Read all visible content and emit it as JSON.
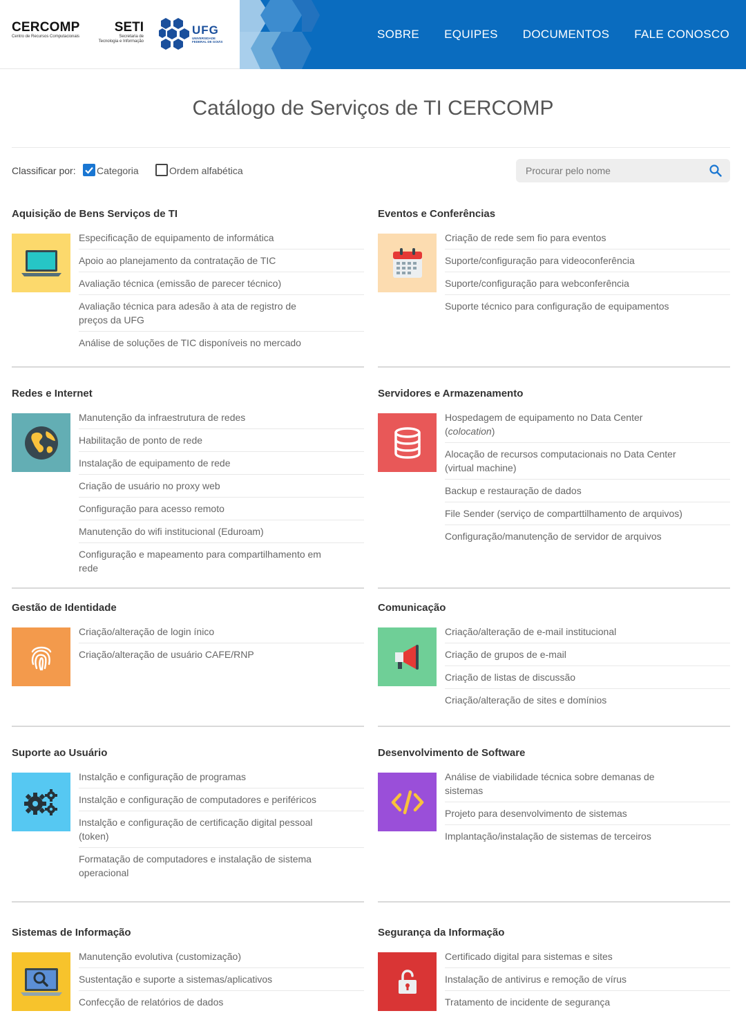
{
  "header": {
    "logos": {
      "cercomp": {
        "name": "CERCOMP",
        "subtitle": "Centro de Recursos Computacionais"
      },
      "seti": {
        "name": "SETI",
        "subtitle_line1": "Secretaria de",
        "subtitle_line2": "Tecnologia e Informação"
      },
      "ufg": {
        "name": "UFG",
        "subtitle_line1": "UNIVERSIDADE",
        "subtitle_line2": "FEDERAL DE GOIÁS"
      }
    },
    "nav": [
      "SOBRE",
      "EQUIPES",
      "DOCUMENTOS",
      "FALE CONOSCO"
    ],
    "band_color": "#0a6cbf"
  },
  "page_title": "Catálogo de Serviços de TI CERCOMP",
  "filters": {
    "sort_label": "Classificar por:",
    "category_label": "Categoria",
    "category_checked": true,
    "alpha_label": "Ordem alfabética",
    "alpha_checked": false,
    "search_placeholder": "Procurar pelo nome"
  },
  "categories": [
    {
      "title": "Aquisição de Bens  Serviços de TI",
      "icon": "laptop-icon",
      "tile_color": "#fcd96c",
      "items": [
        "Especificação de equipamento de informática",
        "Apoio ao planejamento da contratação de TIC",
        "Avaliação técnica (emissão de parecer técnico)",
        "Avaliação técnica para adesão à ata de registro de preços da UFG",
        "Análise de soluções de TIC disponíveis no mercado"
      ]
    },
    {
      "title": "Eventos e Conferências",
      "icon": "calendar-icon",
      "tile_color": "#fcdcb0",
      "items": [
        "Criação de rede sem fio para eventos",
        "Suporte/configuração para videoconferência",
        "Suporte/configuração para webconferência",
        "Suporte técnico para configuração de equipamentos"
      ]
    },
    {
      "title": "Redes e Internet",
      "icon": "globe-icon",
      "tile_color": "#63aeb4",
      "items": [
        "Manutenção da infraestrutura de redes",
        "Habilitação de ponto de rede",
        "Instalação de equipamento de rede",
        "Criação de usuário no proxy web",
        "Configuração para acesso remoto",
        "Manutenção do wifi institucional (Eduroam)",
        "Configuração e mapeamento para compartilhamento em rede"
      ]
    },
    {
      "title": "Servidores e Armazenamento",
      "icon": "database-icon",
      "tile_color": "#e85858",
      "items": [
        "Hospedagem de equipamento no Data Center (",
        "Alocação de recursos computacionais no Data Center (virtual machine)",
        "Backup e restauração de dados",
        "File Sender (serviço de comparttilhamento de arquivos)",
        "Configuração/manutenção de servidor de arquivos"
      ],
      "first_item_italic": "colocation",
      "first_item_suffix": ")"
    },
    {
      "title": "Gestão de Identidade",
      "icon": "fingerprint-icon",
      "tile_color": "#f39a4c",
      "items": [
        "Criação/alteração de login ínico",
        "Criação/alteração de usuário CAFE/RNP"
      ]
    },
    {
      "title": "Comunicação",
      "icon": "megaphone-icon",
      "tile_color": "#6fcf97",
      "items": [
        "Criação/alteração de e-mail institucional",
        "Criação de grupos de e-mail",
        "Criação de listas de discussão",
        "Criação/alteração de sites e domínios"
      ]
    },
    {
      "title": "Suporte ao Usuário",
      "icon": "gears-icon",
      "tile_color": "#56c8f2",
      "items": [
        "Instalção e configuração de programas",
        "Instalção e configuração de computadores e periféricos",
        "Instalção e configuração de certificação digital pessoal (token)",
        "Formatação de computadores e instalação de sistema operacional"
      ]
    },
    {
      "title": "Desenvolvimento de Software",
      "icon": "code-icon",
      "tile_color": "#9a4fd9",
      "items": [
        "Análise de viabilidade técnica sobre demanas de sistemas",
        "Projeto para desenvolvimento de sistemas",
        "Implantação/instalação de sistemas de terceiros"
      ]
    },
    {
      "title": "Sistemas de Informação",
      "icon": "laptop-search-icon",
      "tile_color": "#f7c32c",
      "items": [
        "Manutenção evolutiva (customização)",
        "Sustentação e suporte a sistemas/aplicativos",
        "Confecção de relatórios de dados"
      ]
    },
    {
      "title": "Segurança da Informação",
      "icon": "unlock-icon",
      "tile_color": "#d93535",
      "items": [
        "Certificado digital para sistemas e sites",
        "Instalação de antivirus e remoção de vírus",
        "Tratamento de incidente de segurança"
      ]
    }
  ]
}
